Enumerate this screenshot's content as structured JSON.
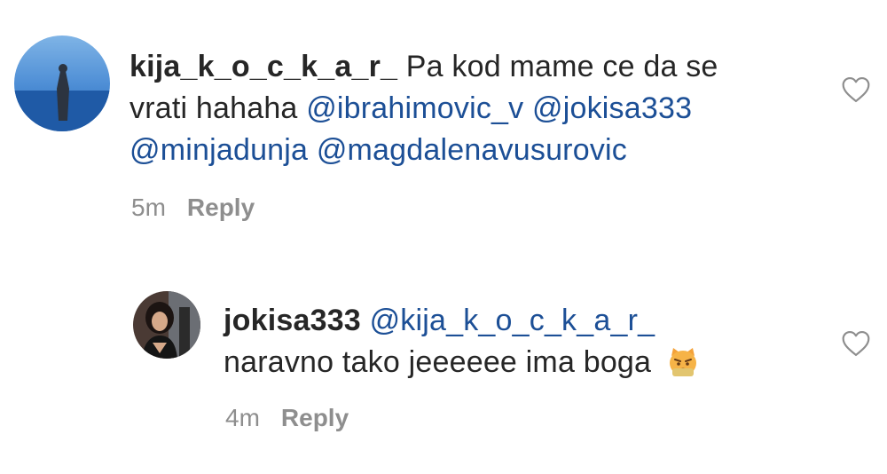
{
  "comments": [
    {
      "username": "kija_k_o_c_k_a_r_",
      "text_line1": "Pa kod mame ce da se",
      "text_line2": "vrati hahaha",
      "mentions": [
        "@ibrahimovic_v",
        "@jokisa333",
        "@minjadunja",
        "@magdalenavusurovic"
      ],
      "time": "5m",
      "reply_label": "Reply"
    },
    {
      "username": "jokisa333",
      "mention": "@kija_k_o_c_k_a_r_",
      "text": "naravno tako jeeeeee ima boga",
      "emoji": "pouting-cat-face",
      "time": "4m",
      "reply_label": "Reply"
    }
  ],
  "colors": {
    "mention": "#1c4f96",
    "meta": "#8e8e8e",
    "text": "#262626"
  }
}
